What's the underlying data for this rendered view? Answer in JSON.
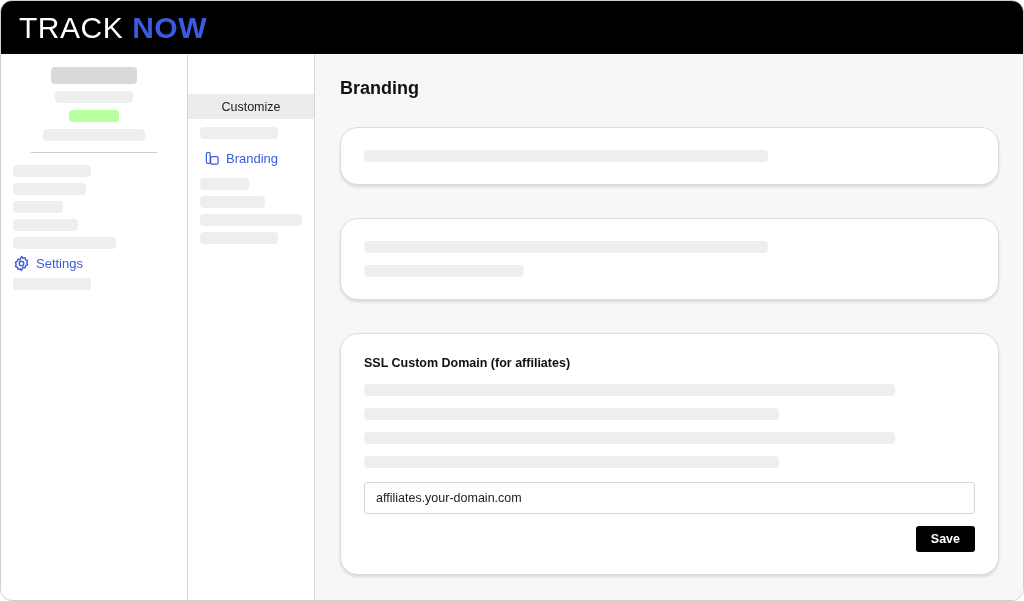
{
  "logo": {
    "brand": "TRACK",
    "accent": "NOW"
  },
  "sidebar": {
    "items": [
      {
        "label": "Settings",
        "selected": true
      }
    ]
  },
  "subnav": {
    "header": "Customize",
    "items": [
      {
        "label": "Branding",
        "selected": true
      }
    ]
  },
  "page": {
    "title": "Branding"
  },
  "domain_card": {
    "title": "SSL Custom Domain (for affiliates)",
    "field": {
      "value": "affiliates.your-domain.com"
    },
    "button": "Save"
  }
}
